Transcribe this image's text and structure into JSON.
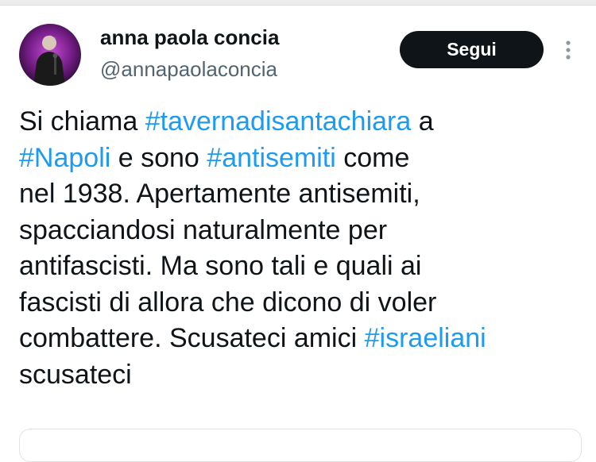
{
  "author": {
    "display_name": "anna paola concia",
    "handle": "@annapaolaconcia",
    "avatar_icon": "person-on-stage-icon"
  },
  "actions": {
    "follow_label": "Segui",
    "more_icon": "vertical-ellipsis-icon"
  },
  "tweet": {
    "lines": [
      [
        "Si chiama ",
        "#tavernadisantachiara",
        " a"
      ],
      [
        "#Napoli",
        " e sono ",
        "#antisemiti",
        " come"
      ],
      [
        "nel 1938. Apertamente antisemiti,"
      ],
      [
        "spacciandosi naturalmente per"
      ],
      [
        "antifascisti. Ma sono tali e quali ai"
      ],
      [
        "fascisti di allora che dicono di voler"
      ],
      [
        "combattere. Scusateci amici ",
        "#israeliani"
      ],
      [
        "scusateci"
      ]
    ],
    "hashtags": [
      "#tavernadisantachiara",
      "#Napoli",
      "#antisemiti",
      "#israeliani"
    ]
  },
  "colors": {
    "hashtag": "#1d9bf0",
    "text": "#0f1419",
    "secondary": "#536471",
    "button_bg": "#0f1419"
  }
}
